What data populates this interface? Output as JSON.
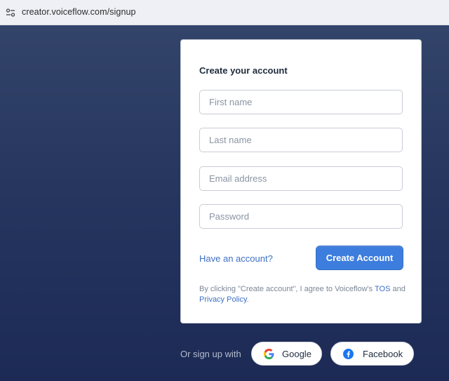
{
  "browser": {
    "url": "creator.voiceflow.com/signup",
    "site_info_icon": "site-info-icon"
  },
  "form": {
    "title": "Create your account",
    "fields": {
      "first_name": {
        "placeholder": "First name",
        "value": ""
      },
      "last_name": {
        "placeholder": "Last name",
        "value": ""
      },
      "email": {
        "placeholder": "Email address",
        "value": ""
      },
      "password": {
        "placeholder": "Password",
        "value": ""
      }
    },
    "have_account_link": "Have an account?",
    "create_button": "Create Account",
    "tos": {
      "prefix": "By clicking \"Create account\", I agree to Voiceflow's ",
      "tos_link": "TOS",
      "and": " and ",
      "privacy_link": "Privacy Policy",
      "suffix": "."
    }
  },
  "social": {
    "label": "Or sign up with",
    "google": {
      "label": "Google",
      "icon": "google-icon"
    },
    "facebook": {
      "label": "Facebook",
      "icon": "facebook-icon"
    }
  },
  "colors": {
    "accent": "#3c7ddd",
    "link": "#3d6fc4",
    "background": "#1f2c54",
    "facebook_blue": "#1877f2"
  }
}
